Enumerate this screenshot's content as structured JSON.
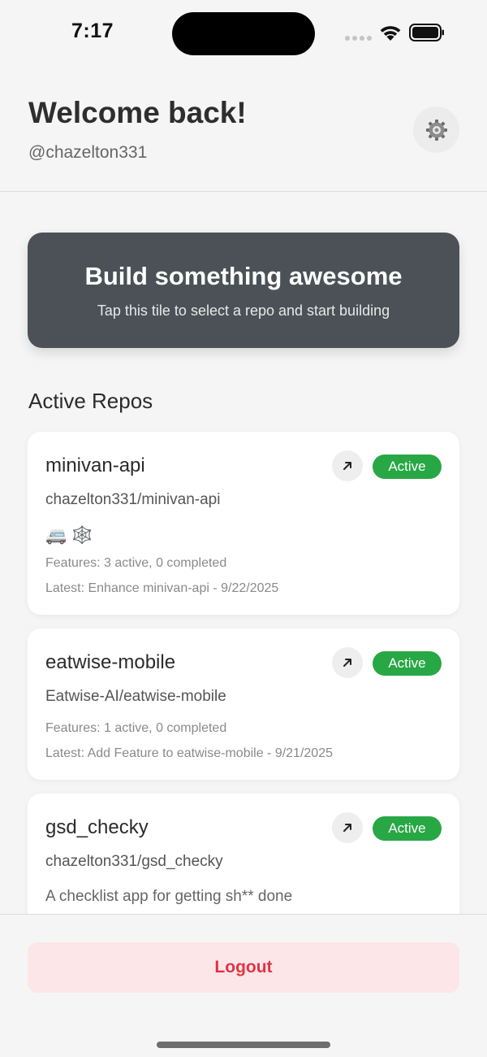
{
  "status_bar": {
    "time": "7:17",
    "icons": [
      "cellular-signal-icon",
      "wifi-icon",
      "battery-icon"
    ]
  },
  "header": {
    "title": "Welcome back!",
    "username": "@chazelton331",
    "settings_icon": "gear-icon"
  },
  "hero": {
    "title": "Build something awesome",
    "subtitle": "Tap this tile to select a repo and start building"
  },
  "section": {
    "title": "Active Repos"
  },
  "repos": [
    {
      "name": "minivan-api",
      "full_name": "chazelton331/minivan-api",
      "status": "Active",
      "emojis": [
        "🚐",
        "🕸️"
      ],
      "features": "Features: 3 active, 0 completed",
      "latest": "Latest: Enhance minivan-api - 9/22/2025"
    },
    {
      "name": "eatwise-mobile",
      "full_name": "Eatwise-AI/eatwise-mobile",
      "status": "Active",
      "features": "Features: 1 active, 0 completed",
      "latest": "Latest: Add Feature to eatwise-mobile - 9/21/2025"
    },
    {
      "name": "gsd_checky",
      "full_name": "chazelton331/gsd_checky",
      "status": "Active",
      "description": "A checklist app for getting sh** done"
    }
  ],
  "footer": {
    "logout_label": "Logout"
  },
  "colors": {
    "active_badge": "#28a745",
    "hero_bg": "#4b5157",
    "logout_text": "#dc3545",
    "logout_bg": "#fde6e8"
  }
}
